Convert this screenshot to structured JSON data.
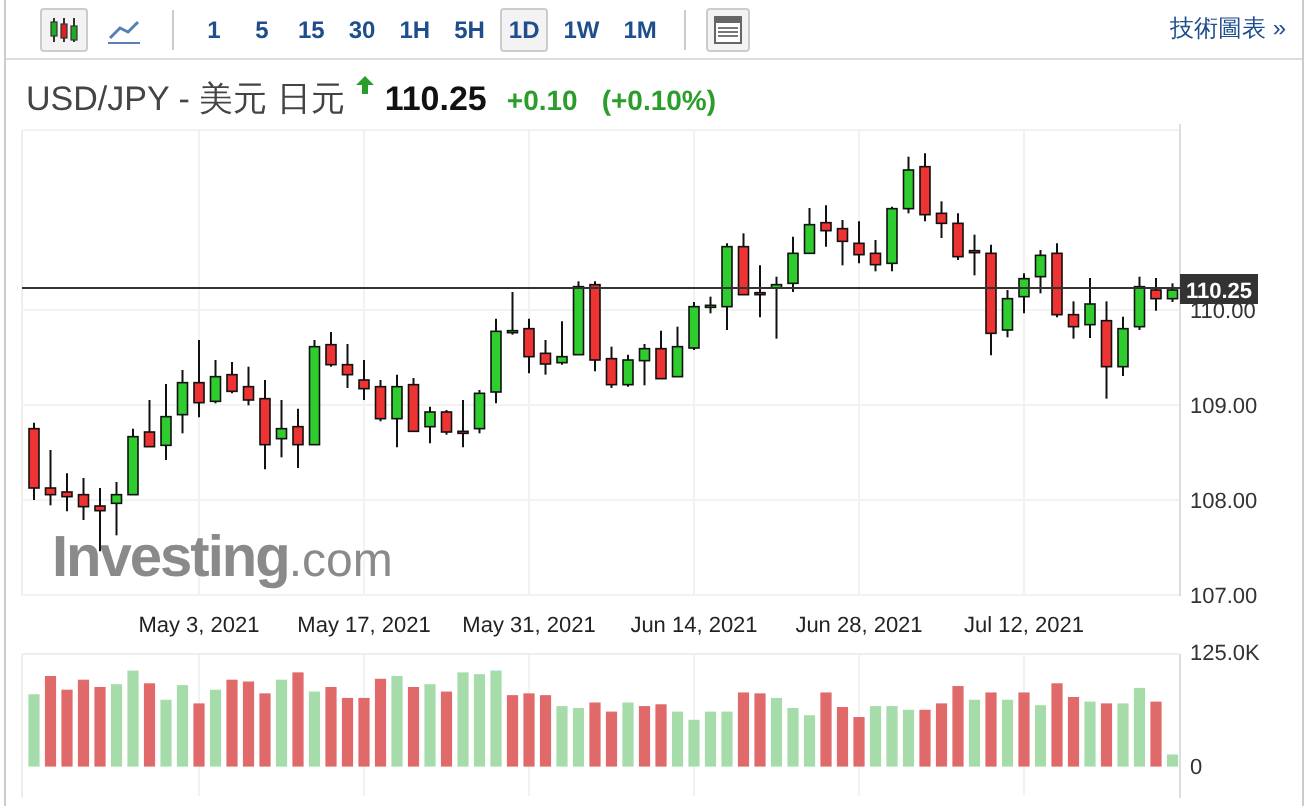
{
  "toolbar": {
    "chart_types": [
      {
        "kind": "candles",
        "selected": true
      },
      {
        "kind": "line",
        "selected": false
      }
    ],
    "intervals": [
      {
        "label": "1",
        "selected": false
      },
      {
        "label": "5",
        "selected": false
      },
      {
        "label": "15",
        "selected": false
      },
      {
        "label": "30",
        "selected": false
      },
      {
        "label": "1H",
        "selected": false
      },
      {
        "label": "5H",
        "selected": false
      },
      {
        "label": "1D",
        "selected": true
      },
      {
        "label": "1W",
        "selected": false
      },
      {
        "label": "1M",
        "selected": false
      }
    ],
    "link": "技術圖表 »"
  },
  "header": {
    "pair": "USD/JPY - 美元 日元",
    "rising": true,
    "price": "110.25",
    "change": "+0.10",
    "change_percent": "(+0.10%)"
  },
  "chart": {
    "price_axis": [
      "110.00",
      "109.00",
      "108.00",
      "107.00"
    ],
    "current_price": "110.25",
    "dates": [
      "May 3, 2021",
      "May 17, 2021",
      "May 31, 2021",
      "Jun 14, 2021",
      "Jun 28, 2021",
      "Jul 12, 2021"
    ],
    "logo": "**Investing**.com",
    "volume": {
      "chart_data": {
        "type": "bar",
        "stacked": true,
        "grid": true,
        "ylim": [
          0,
          125
        ],
        "yticks": [
          {
            "value": 0,
            "label": "0"
          },
          {
            "value": 125,
            "label": "125.0K"
          }
        ],
        "series": [
          {
            "color": "#a6dcaa",
            "values": [
              78,
              null,
              null,
              null,
              null,
              89,
              104,
              null,
              72,
              88,
              null,
              83,
              null,
              null,
              null,
              94,
              null,
              81,
              null,
              null,
              null,
              null,
              98,
              null,
              89,
              null,
              102,
              100,
              104,
              null,
              null,
              null,
              65,
              63,
              null,
              null,
              69,
              null,
              null,
              59,
              50,
              59,
              59,
              null,
              null,
              74,
              63,
              55,
              null,
              null,
              null,
              65,
              65,
              61,
              null,
              null,
              null,
              72,
              null,
              72,
              null,
              66,
              null,
              null,
              70,
              null,
              68,
              85,
              null,
              12
            ]
          },
          {
            "color": "#e06a6a",
            "values": [
              null,
              98,
              83,
              94,
              86,
              null,
              null,
              90,
              null,
              null,
              68,
              null,
              94,
              92,
              79,
              null,
              102,
              null,
              86,
              74,
              74,
              95,
              null,
              86,
              null,
              81,
              null,
              null,
              null,
              77,
              79,
              77,
              null,
              null,
              69,
              59,
              null,
              65,
              67,
              null,
              null,
              null,
              null,
              80,
              79,
              null,
              null,
              null,
              80,
              64,
              53,
              null,
              null,
              null,
              61,
              68,
              87,
              null,
              80,
              null,
              80,
              null,
              90,
              75,
              null,
              68,
              null,
              null,
              70,
              null
            ]
          }
        ]
      }
    }
  }
}
